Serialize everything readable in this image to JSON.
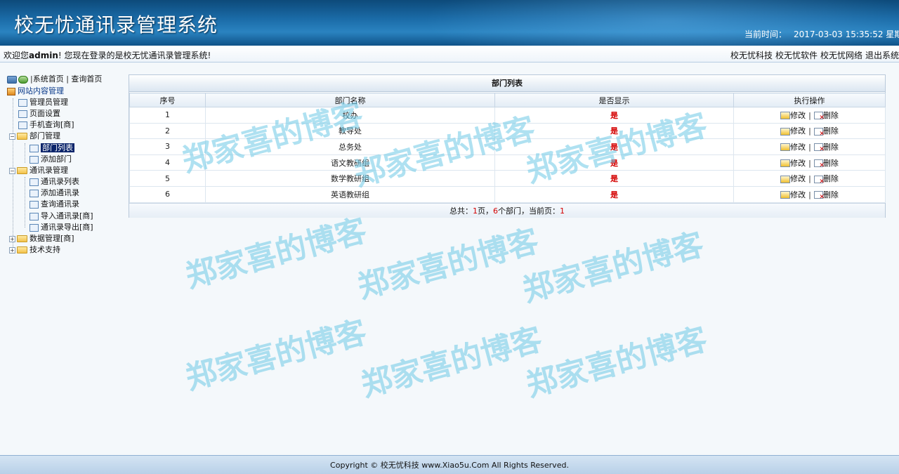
{
  "header": {
    "title": "校无忧通讯录管理系统",
    "clock_label": "当前时间：",
    "clock_value": "2017-03-03 15:35:52 星期"
  },
  "welcome": {
    "prefix": "欢迎您",
    "user": "admin",
    "suffix": "! 您现在登录的是校无忧通讯录管理系统!",
    "links": [
      "校无忧科技",
      "校无忧软件",
      "校无忧网络",
      "退出系统"
    ]
  },
  "sidebar": {
    "top_links": [
      "系统首页",
      "查询首页"
    ],
    "root": "网站内容管理",
    "items": [
      {
        "label": "管理员管理"
      },
      {
        "label": "页面设置"
      },
      {
        "label": "手机查询[商]"
      },
      {
        "label": "部门管理"
      },
      {
        "label": "部门列表"
      },
      {
        "label": "添加部门"
      },
      {
        "label": "通讯录管理"
      },
      {
        "label": "通讯录列表"
      },
      {
        "label": "添加通讯录"
      },
      {
        "label": "查询通讯录"
      },
      {
        "label": "导入通讯录[商]"
      },
      {
        "label": "通讯录导出[商]"
      },
      {
        "label": "数据管理[商]"
      },
      {
        "label": "技术支持"
      }
    ]
  },
  "table": {
    "caption": "部门列表",
    "headers": [
      "序号",
      "部门名称",
      "是否显示",
      "执行操作"
    ],
    "edit_label": "修改",
    "delete_label": "删除",
    "rows": [
      {
        "no": "1",
        "name": "校办",
        "show": "是"
      },
      {
        "no": "2",
        "name": "教导处",
        "show": "是"
      },
      {
        "no": "3",
        "name": "总务处",
        "show": "是"
      },
      {
        "no": "4",
        "name": "语文教研组",
        "show": "是"
      },
      {
        "no": "5",
        "name": "数学教研组",
        "show": "是"
      },
      {
        "no": "6",
        "name": "英语教研组",
        "show": "是"
      }
    ],
    "footer": {
      "total_label": "总共：",
      "pages": "1",
      "pages_unit": "页，",
      "count": "6",
      "count_unit": "个部门，当前页：",
      "current": "1"
    }
  },
  "watermark": "郑家喜的博客",
  "bottom": {
    "copyright": "Copyright © 校无忧科技  www.Xiao5u.Com All Rights Reserved."
  }
}
